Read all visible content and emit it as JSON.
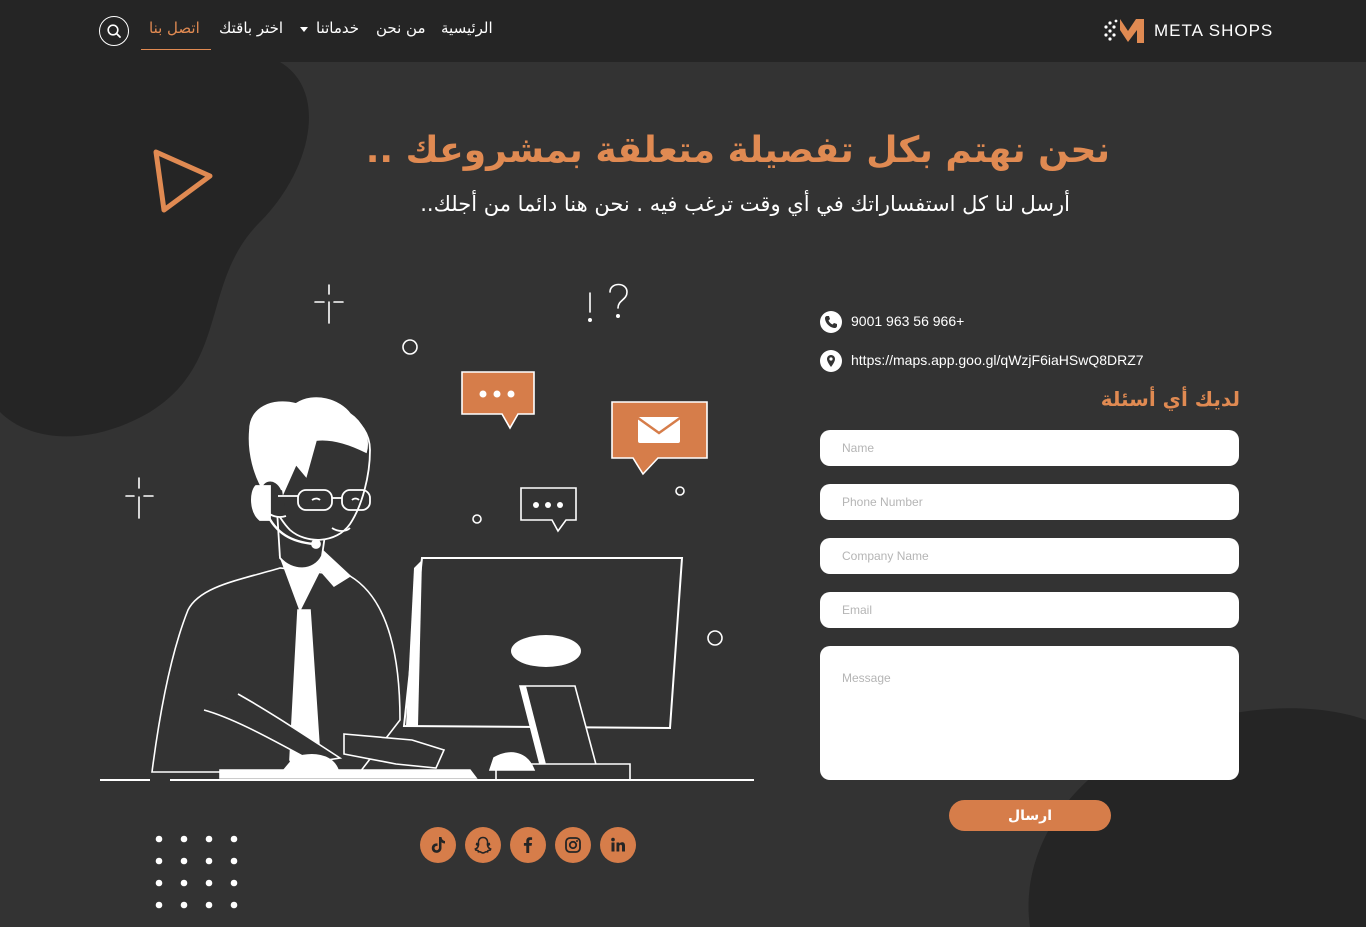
{
  "nav": {
    "logo_text": "META SHOPS",
    "links": [
      {
        "label": "الرئيسية"
      },
      {
        "label": "من نحن"
      },
      {
        "label": "خدماتنا"
      },
      {
        "label": "اختر باقتك"
      },
      {
        "label": "اتصل بنا"
      }
    ],
    "search_icon": "search-icon",
    "accent": "#e08a52"
  },
  "hero": {
    "headline": "نحن نهتم بكل تفصيلة متعلقة بمشروعك ..",
    "subhead": "أرسل لنا كل استفساراتك في أي وقت ترغب فيه . نحن هنا دائما من أجلك.."
  },
  "contact": {
    "phone": "9001 963 56 966+",
    "map_url": "https://maps.app.goo.gl/qWzjF6iaHSwQ8DRZ7",
    "phone_icon": "phone-icon",
    "location_icon": "location-pin-icon"
  },
  "form": {
    "title": "لديك أي أسئلة",
    "name_placeholder": "Name",
    "phone_placeholder": "Phone Number",
    "company_placeholder": "Company Name",
    "email_placeholder": "Email",
    "message_placeholder": "Message",
    "submit_label": "ارسال"
  },
  "social": [
    {
      "icon": "tiktok-icon"
    },
    {
      "icon": "snapchat-icon"
    },
    {
      "icon": "facebook-icon"
    },
    {
      "icon": "instagram-icon"
    },
    {
      "icon": "linkedin-icon"
    }
  ],
  "colors": {
    "background": "#333333",
    "navbar": "#252525",
    "accent": "#e08a52",
    "button": "#d67d4a"
  }
}
